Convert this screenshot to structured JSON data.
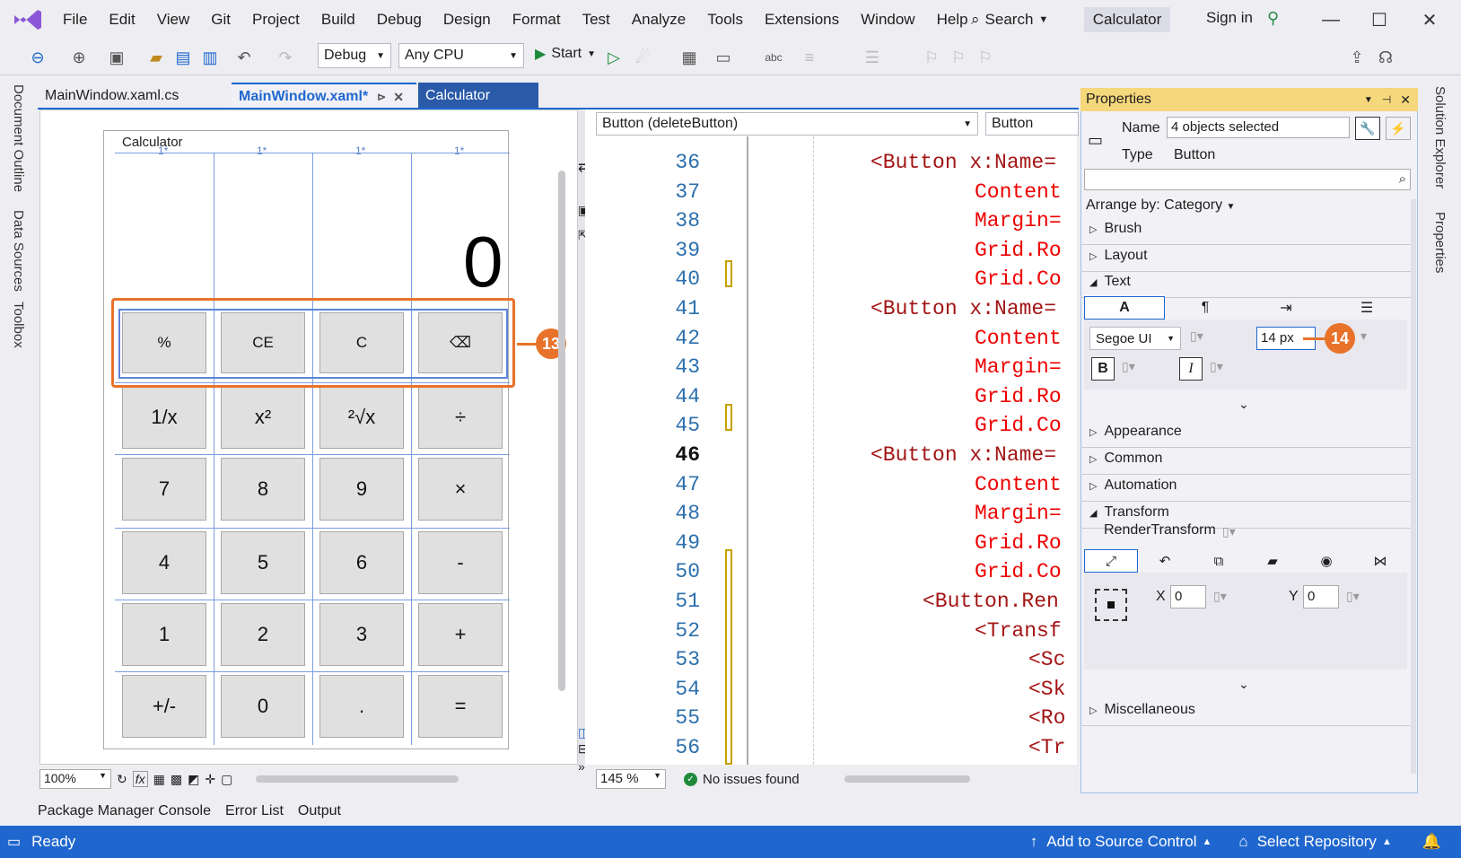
{
  "menu": [
    "File",
    "Edit",
    "View",
    "Git",
    "Project",
    "Build",
    "Debug",
    "Design",
    "Format",
    "Test",
    "Analyze",
    "Tools",
    "Extensions",
    "Window",
    "Help"
  ],
  "search_label": "Search",
  "solution_name": "Calculator",
  "sign_in": "Sign in",
  "toolbar": {
    "config": "Debug",
    "platform": "Any CPU",
    "start": "Start"
  },
  "left_strip": [
    "Document Outline",
    "Data Sources",
    "Toolbox"
  ],
  "tabs": [
    {
      "label": "MainWindow.xaml.cs",
      "active": false
    },
    {
      "label": "MainWindow.xaml*",
      "active": true
    },
    {
      "label": "Calculator",
      "active": false
    }
  ],
  "designer": {
    "window_title": "Calculator",
    "col_markers": [
      "1*",
      "1*",
      "1*",
      "1*"
    ],
    "display": "0",
    "rows": [
      [
        "%",
        "CE",
        "C",
        "⌫"
      ],
      [
        "1/x",
        "x²",
        "²√x",
        "÷"
      ],
      [
        "7",
        "8",
        "9",
        "×"
      ],
      [
        "4",
        "5",
        "6",
        "-"
      ],
      [
        "1",
        "2",
        "3",
        "+"
      ],
      [
        "+/-",
        "0",
        ".",
        "="
      ]
    ],
    "zoom": "100%",
    "fx": "fx"
  },
  "editor": {
    "element_selector": "Button (deleteButton)",
    "member_selector": "Button",
    "zoom": "145 %",
    "issues": "No issues found",
    "lines": [
      {
        "n": "36",
        "t": "<Button x:Name="
      },
      {
        "n": "37",
        "t": "Content"
      },
      {
        "n": "38",
        "t": "Margin="
      },
      {
        "n": "39",
        "t": "Grid.Ro"
      },
      {
        "n": "40",
        "t": "Grid.Co"
      },
      {
        "n": "41",
        "t": "<Button x:Name="
      },
      {
        "n": "42",
        "t": "Content"
      },
      {
        "n": "43",
        "t": "Margin="
      },
      {
        "n": "44",
        "t": "Grid.Ro"
      },
      {
        "n": "45",
        "t": "Grid.Co"
      },
      {
        "n": "46",
        "t": "<Button x:Name="
      },
      {
        "n": "47",
        "t": "Content"
      },
      {
        "n": "48",
        "t": "Margin="
      },
      {
        "n": "49",
        "t": "Grid.Ro"
      },
      {
        "n": "50",
        "t": "Grid.Co"
      },
      {
        "n": "51",
        "t": "<Button.Ren"
      },
      {
        "n": "52",
        "t": "<Transf"
      },
      {
        "n": "53",
        "t": "<Sc"
      },
      {
        "n": "54",
        "t": "<Sk"
      },
      {
        "n": "55",
        "t": "<Ro"
      },
      {
        "n": "56",
        "t": "<Tr"
      }
    ]
  },
  "properties": {
    "title": "Properties",
    "name_label": "Name",
    "name_value": "4 objects selected",
    "type_label": "Type",
    "type_value": "Button",
    "arrange": "Arrange by: Category",
    "categories": [
      "Brush",
      "Layout",
      "Text",
      "Appearance",
      "Common",
      "Automation",
      "Transform",
      "Miscellaneous"
    ],
    "font": "Segoe UI",
    "font_size": "14 px",
    "bold": "B",
    "italic": "I",
    "text_tab_a": "A",
    "text_tab_para": "¶",
    "render_transform": "RenderTransform",
    "x_label": "X",
    "x_value": "0",
    "y_label": "Y",
    "y_value": "0"
  },
  "right_strip": [
    "Solution Explorer",
    "Properties"
  ],
  "bottom_tabs": [
    "Package Manager Console",
    "Error List",
    "Output"
  ],
  "status": {
    "ready": "Ready",
    "source_control": "Add to Source Control",
    "repository": "Select Repository"
  },
  "callouts": [
    "13",
    "14"
  ],
  "colors": {
    "accent": "#1f67cf",
    "callout": "#e8722a",
    "selection": "#7a9fe0"
  }
}
